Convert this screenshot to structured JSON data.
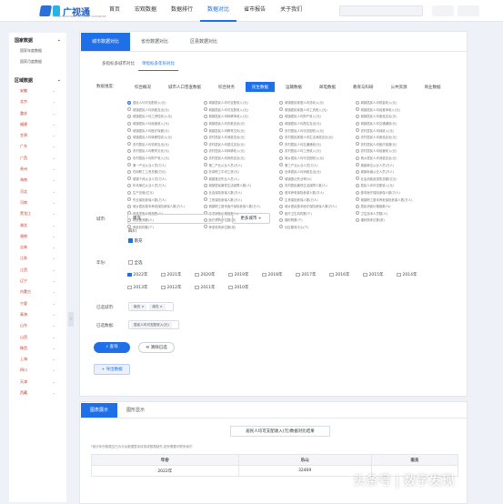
{
  "header": {
    "logo": "广视通",
    "logo_sub": "CHINA NATIONAL ECONOMY DATABASE",
    "nav": [
      "首页",
      "宏观数据",
      "数据排行",
      "数据对比",
      "省市报告",
      "关于我们"
    ],
    "active_nav": 3
  },
  "sidebar": {
    "h1": "国家数据",
    "s1": "国家年度数据",
    "s2": "国家月度数据",
    "h2": "区域数据",
    "provinces": [
      "安徽",
      "北京",
      "重庆",
      "福建",
      "甘肃",
      "广东",
      "广西",
      "贵州",
      "海南",
      "河北",
      "河南",
      "黑龙江",
      "湖北",
      "湖南",
      "吉林",
      "江苏",
      "江西",
      "辽宁",
      "内蒙古",
      "宁夏",
      "青海",
      "山东",
      "山西",
      "陕西",
      "上海",
      "四川",
      "天津",
      "西藏"
    ]
  },
  "main": {
    "tabs": [
      "城市数据对比",
      "省份数据对比",
      "区县数据对比"
    ],
    "subtabs": [
      "多指标多城市对比",
      "单指标多年份对比"
    ],
    "dim_label": "数据维度:",
    "dims": [
      "综合概况",
      "城市人口普查数据",
      "综合财务",
      "民生数据",
      "运输数据",
      "邮电数据",
      "教育与科研",
      "公共资源",
      "商业数据"
    ],
    "indicators": [
      "居民人均可支配收入(元)",
      "城镇居民人均可支配收入(元)",
      "城镇居民家庭人均总收入(元)",
      "城镇居民人均现金收入(元)",
      "城镇居民人均消费支出(元)",
      "城镇居民人均可支配收入(元)",
      "城镇居民家庭人均工资收入(元)",
      "城镇居民人均经营净收入(元)",
      "城镇居民人均工资性收入(元)",
      "城镇居民人均转移净收入(元)",
      "城镇居民人均财产收入(元)",
      "城镇居民人均食品支出(元)",
      "城镇居民人均经营收入(元)",
      "城镇居民人均衣着支出(元)",
      "城镇居民人均居住支出(元)",
      "城镇居民人均交通通信(元)",
      "城镇居民人均医疗保健(元)",
      "城镇居民人均教育文化(元)",
      "农村居民人均可支配收入(元)",
      "农村居民人均纯收入(元)",
      "城镇居民人均转移性收入(元)",
      "农村居民人均消费支出(元)",
      "农村居民家庭人均生活消费支出(元)",
      "农村居民人均食品支出(元)",
      "农村居民人均衣着支出(元)",
      "农村居民人均居住支出(元)",
      "农村居民人均交通通信(元)",
      "农村居民人均医疗保健(元)",
      "农村居民人均教育文化(元)",
      "农村居民人均转移收入(元)",
      "农村居民人均工资收入(元)",
      "农村居民人均经营收入(元)",
      "农村居民人均财产收入(元)",
      "农村居民人均其他支出(元)",
      "城乡居民人均可支配收入(元)",
      "城乡居民人均消费支出(元)",
      "第一产业从业人员(万人)",
      "第二产业从业人员(万人)",
      "第三产业从业人员(万人)",
      "城镇单位从业人员(万人)",
      "在岗职工工资总额(万元)",
      "在岗职工平均工资(元)",
      "全体居民人均消费支出(元)",
      "城镇私营从业人员(万人)",
      "城镇个体从业人员(万人)",
      "城镇登记失业人员(人)",
      "城镇登记失业率(%)",
      "社会消费品零售总额(亿元)",
      "年末单位从业人员(万人)",
      "城镇居民最低生活保障人数(人)",
      "农村居民最低生活保障人数(人)",
      "居民人均可支配收入(元)",
      "生产总值(亿元)",
      "社会保险参保人数(万人)",
      "基本养老保险参保人数(万人)",
      "基本医疗保险参保人数(万人)",
      "失业保险参保人数(万人)",
      "工伤保险参保人数(万人)",
      "生育保险参保人数(万人)",
      "城镇职工基本养老保险参保人数(万人)",
      "城乡居民基本养老保险参保人数(万人)",
      "城镇职工基本医疗保险参保人数(万人)",
      "城乡居民基本医疗保险参保人数(万人)",
      "居民消费价格指数(%)",
      "商品零售价格指数(%)",
      "住宅销售价格指数(%)",
      "医疗卫生机构数(个)",
      "卫生技术人员数(人)",
      "执业医师数(人)",
      "医疗机构床位数(张)",
      "福利院数(个)",
      "福利院床位数(张)",
      "养老机构数(个)",
      "养老机构床位数(张)",
      "社区服务中心(个)"
    ],
    "selected_indicator": 0,
    "city_label": "城市:",
    "city_value": "南充",
    "more_city": "更多城市 +",
    "group_label": "四川",
    "group_checked": "南充",
    "year_label": "年份:",
    "all_label": "全选",
    "years": [
      "2022年",
      "2021年",
      "2020年",
      "2019年",
      "2018年",
      "2017年",
      "2016年",
      "2015年",
      "2014年",
      "2013年",
      "2012年",
      "2011年",
      "2010年"
    ],
    "checked_years": [
      0
    ],
    "sel_city_label": "已选城市:",
    "sel_cities": [
      "南充",
      "南充"
    ],
    "sel_data_label": "已选数据:",
    "sel_data": "居民人均可支配收入(元)",
    "query": "查询",
    "clear": "清除已选",
    "export": "导出数据"
  },
  "result": {
    "tabs": [
      "图表展示",
      "图形显示"
    ],
    "title": "居民人均可支配收入(元)数据对比结果",
    "note": "*部分年份数据空白为平台数据暂未收录或数据缺失,若有需要可联系我们",
    "headers": [
      "年份",
      "乐山",
      "南充"
    ],
    "rows": [
      [
        "2022年",
        "32469",
        ""
      ]
    ]
  },
  "watermark": "头条号 | 数字发现"
}
